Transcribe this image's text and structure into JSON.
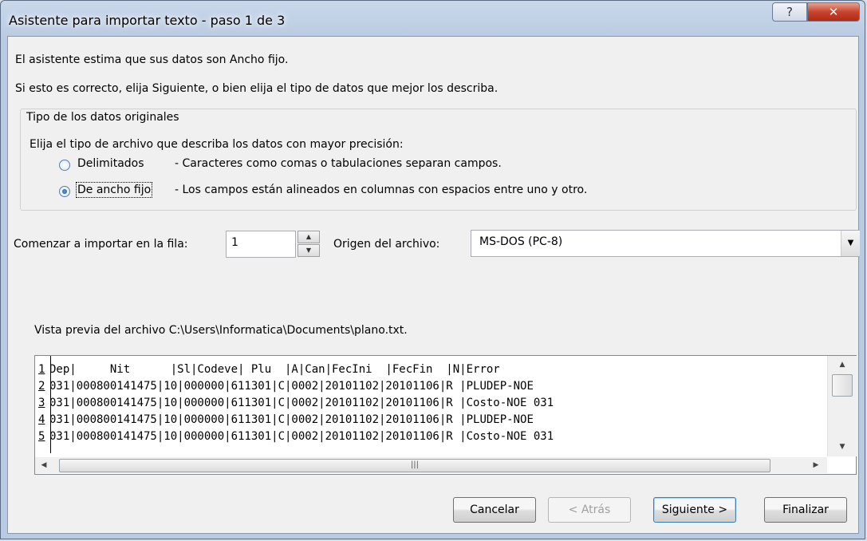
{
  "window": {
    "title": "Asistente para importar texto - paso 1 de 3"
  },
  "intro": {
    "line1": "El asistente estima que sus datos son Ancho fijo.",
    "line2": "Si esto es correcto, elija Siguiente, o bien elija el tipo de datos que mejor los describa."
  },
  "data_type": {
    "group_title": "Tipo de los datos originales",
    "prompt": "Elija el tipo de archivo que describa los datos con mayor precisión:",
    "options": [
      {
        "label": "Delimitados",
        "description": "- Caracteres como comas o tabulaciones separan campos.",
        "checked": false
      },
      {
        "label": "De ancho fijo",
        "description": "- Los campos están alineados en columnas con espacios entre uno y otro.",
        "checked": true
      }
    ]
  },
  "start_row": {
    "label": "Comenzar a importar en la fila:",
    "value": "1"
  },
  "origin": {
    "label": "Origen del archivo:",
    "value": "MS-DOS (PC-8)"
  },
  "preview": {
    "caption": "Vista previa del archivo C:\\Users\\Informatica\\Documents\\plano.txt.",
    "rows": [
      {
        "num": "1",
        "text": "Dep|     Nit      |Sl|Codeve| Plu  |A|Can|FecIni  |FecFin  |N|Error"
      },
      {
        "num": "2",
        "text": "031|000800141475|10|000000|611301|C|0002|20101102|20101106|R |PLUDEP-NOE"
      },
      {
        "num": "3",
        "text": "031|000800141475|10|000000|611301|C|0002|20101102|20101106|R |Costo-NOE 031"
      },
      {
        "num": "4",
        "text": "031|000800141475|10|000000|611301|C|0002|20101102|20101106|R |PLUDEP-NOE"
      },
      {
        "num": "5",
        "text": "031|000800141475|10|000000|611301|C|0002|20101102|20101106|R |Costo-NOE 031"
      }
    ]
  },
  "buttons": {
    "cancel": "Cancelar",
    "back": "< Atrás",
    "next": "Siguiente >",
    "finish": "Finalizar"
  },
  "icons": {
    "help": "help-icon",
    "close": "close-icon"
  }
}
